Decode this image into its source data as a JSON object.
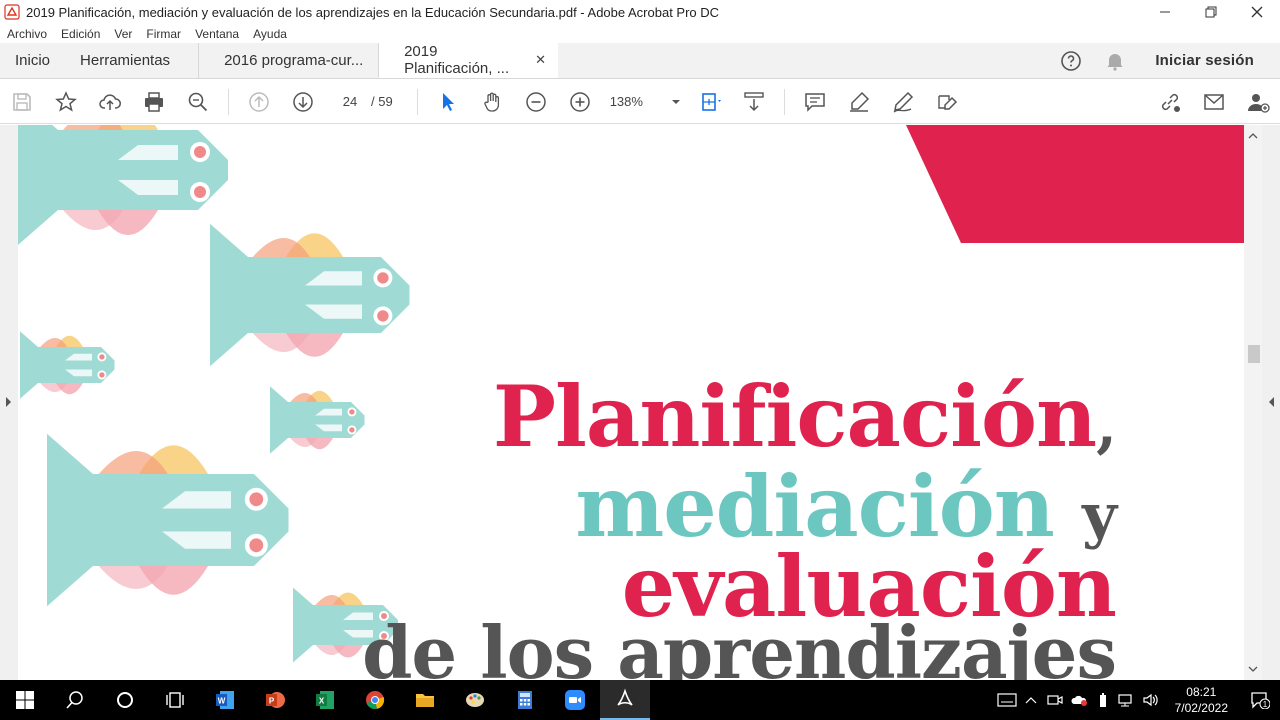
{
  "window": {
    "title": "2019 Planificación, mediación y evaluación de los aprendizajes en la Educación Secundaria.pdf - Adobe Acrobat Pro DC"
  },
  "menu": [
    "Archivo",
    "Edición",
    "Ver",
    "Firmar",
    "Ventana",
    "Ayuda"
  ],
  "tabs": {
    "home": "Inicio",
    "tools": "Herramientas",
    "doc1": "2016 programa-cur...",
    "doc2": "2019 Planificación, ...",
    "signin": "Iniciar sesión"
  },
  "toolbar": {
    "page_current": "24",
    "page_total": "/ 59",
    "zoom": "138%"
  },
  "cover": {
    "line1": "Planificación",
    "comma": ",",
    "line2": "mediación",
    "y": "y",
    "line3": "evaluación",
    "line4": "de los aprendizajes"
  },
  "taskbar": {
    "time": "08:21",
    "date": "7/02/2022",
    "notifications": "1"
  },
  "colors": {
    "accent_red": "#e0234e",
    "accent_teal": "#6cc7c1",
    "text_gray": "#555555"
  }
}
